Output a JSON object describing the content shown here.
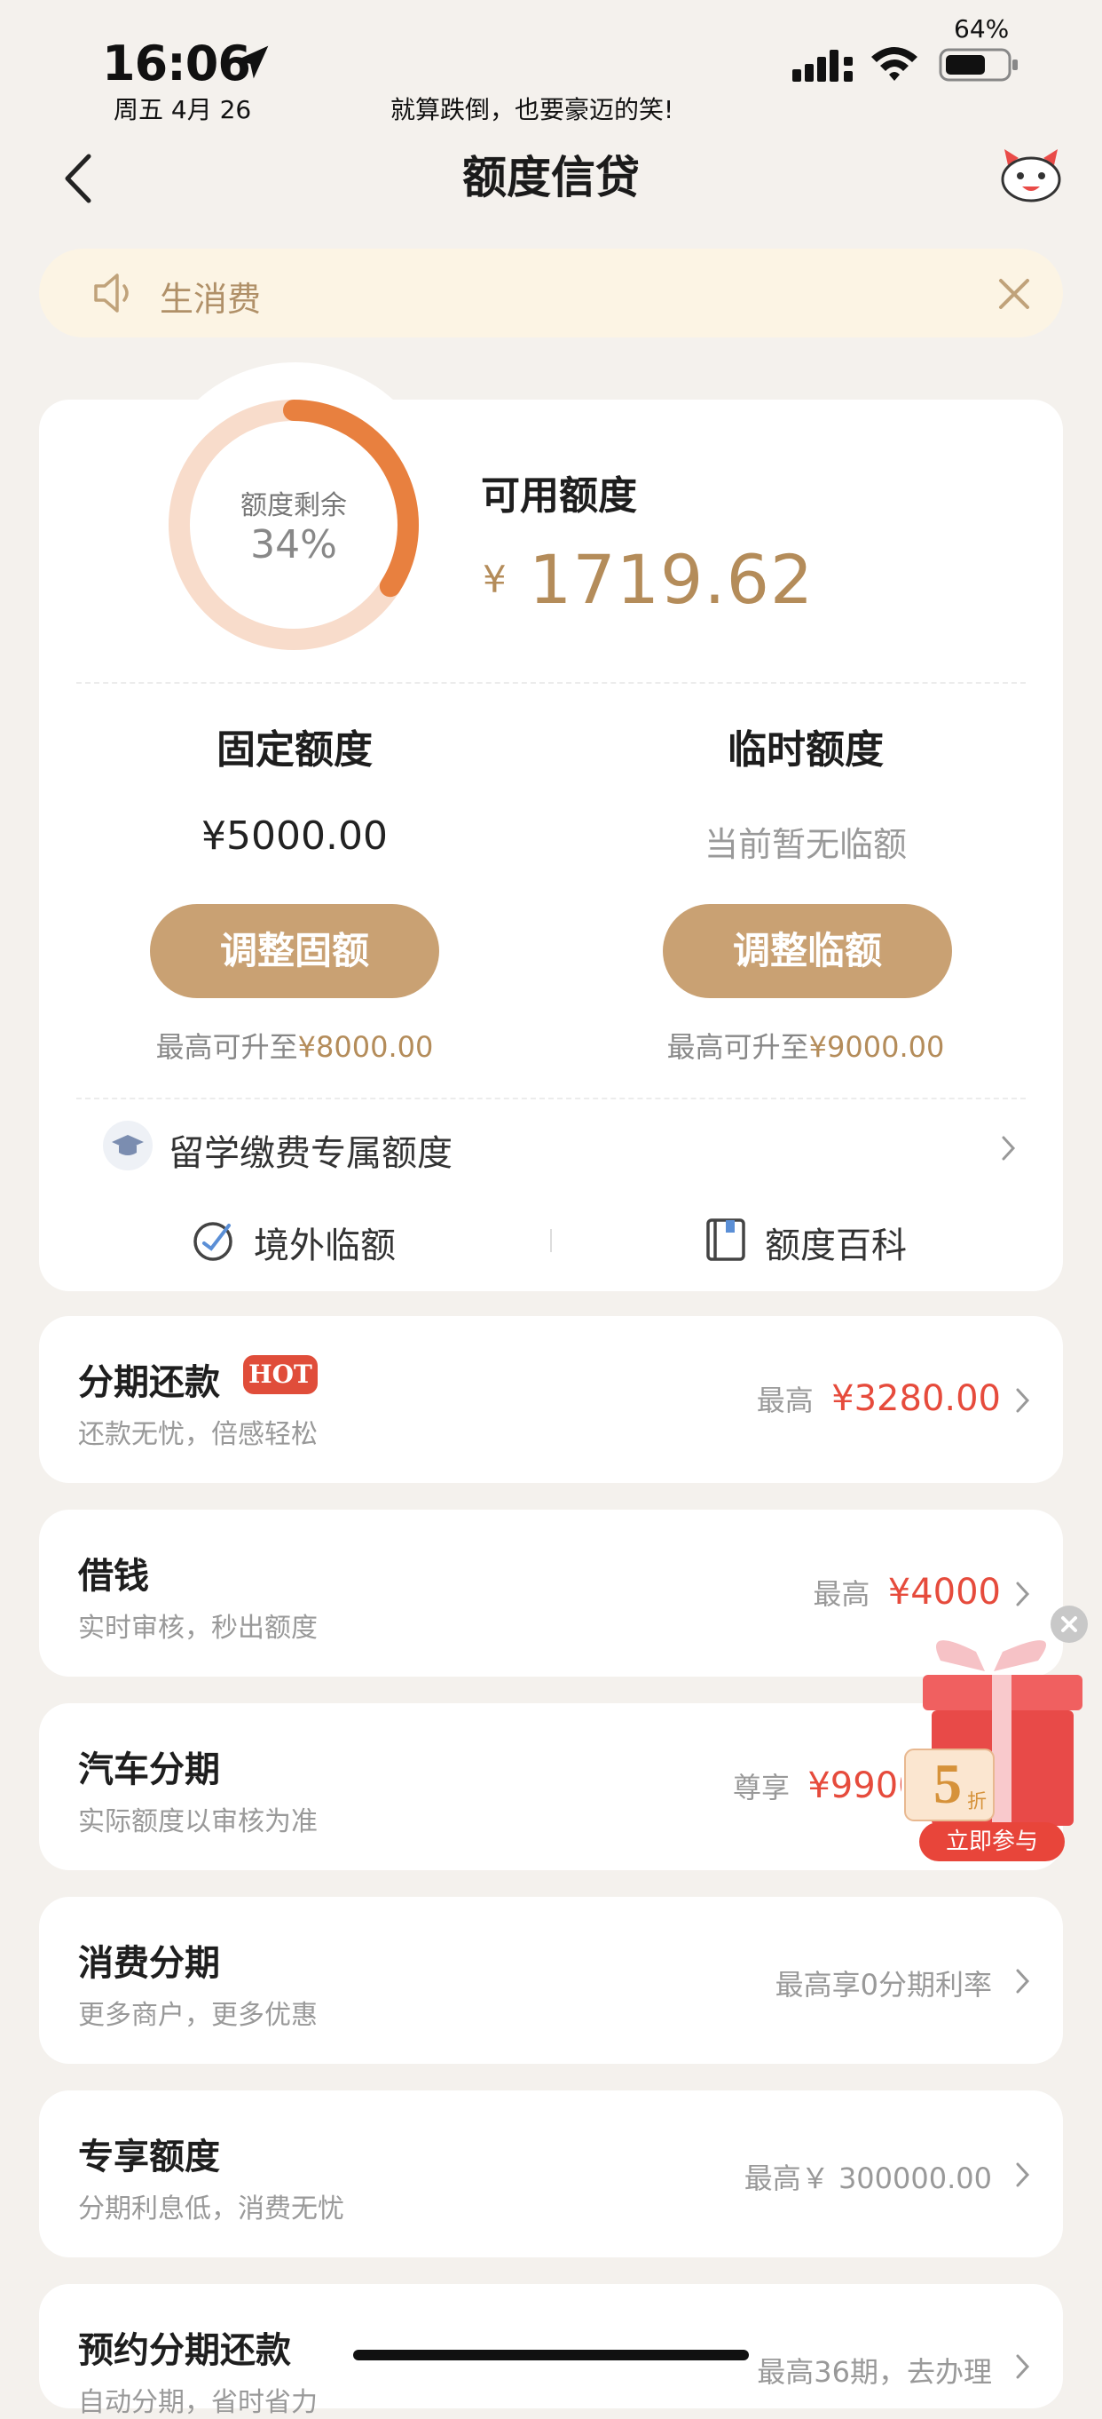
{
  "status_bar": {
    "time": "16:06",
    "date": "周五 4月 26",
    "motto": "就算跌倒，也要豪迈的笑!",
    "battery_percent": "64%"
  },
  "header": {
    "title": "额度信贷"
  },
  "notice": {
    "text": "生消费"
  },
  "credit": {
    "ring_label": "额度剩余",
    "ring_percent": "34%",
    "remaining_fraction": 0.34,
    "available_title": "可用额度",
    "currency": "¥",
    "available_amount": "1719.62",
    "fixed": {
      "title": "固定额度",
      "value": "¥5000.00",
      "button": "调整固额",
      "max_prefix": "最高可升至",
      "max_amount": "¥8000.00"
    },
    "temporary": {
      "title": "临时额度",
      "value": "当前暂无临额",
      "button": "调整临额",
      "max_prefix": "最高可升至",
      "max_amount": "¥9000.00"
    },
    "study_abroad": "留学缴费专属额度",
    "overseas": "境外临额",
    "encyclopedia": "额度百科"
  },
  "list": [
    {
      "title": "分期还款",
      "badge": "HOT",
      "subtitle": "还款无忧，倍感轻松",
      "right_prefix": "最高",
      "right_amount": "¥3280.00"
    },
    {
      "title": "借钱",
      "subtitle": "实时审核，秒出额度",
      "right_prefix": "最高",
      "right_amount": "¥4000"
    },
    {
      "title": "汽车分期",
      "subtitle": "实际额度以审核为准",
      "right_prefix": "尊享",
      "right_amount": "¥9900"
    },
    {
      "title": "消费分期",
      "subtitle": "更多商户，更多优惠",
      "right_text": "最高享0分期利率"
    },
    {
      "title": "专享额度",
      "subtitle": "分期利息低，消费无忧",
      "right_text": "最高￥ 300000.00"
    },
    {
      "title": "预约分期还款",
      "subtitle": "自动分期，省时省力",
      "right_text": "最高36期，去办理"
    }
  ],
  "promo": {
    "discount": "5",
    "discount_unit": "折",
    "cta": "立即参与"
  },
  "colors": {
    "gold": "#c9a173",
    "accent_text": "#b48c5a",
    "red": "#e64b3c",
    "ring": "#e8803f"
  }
}
